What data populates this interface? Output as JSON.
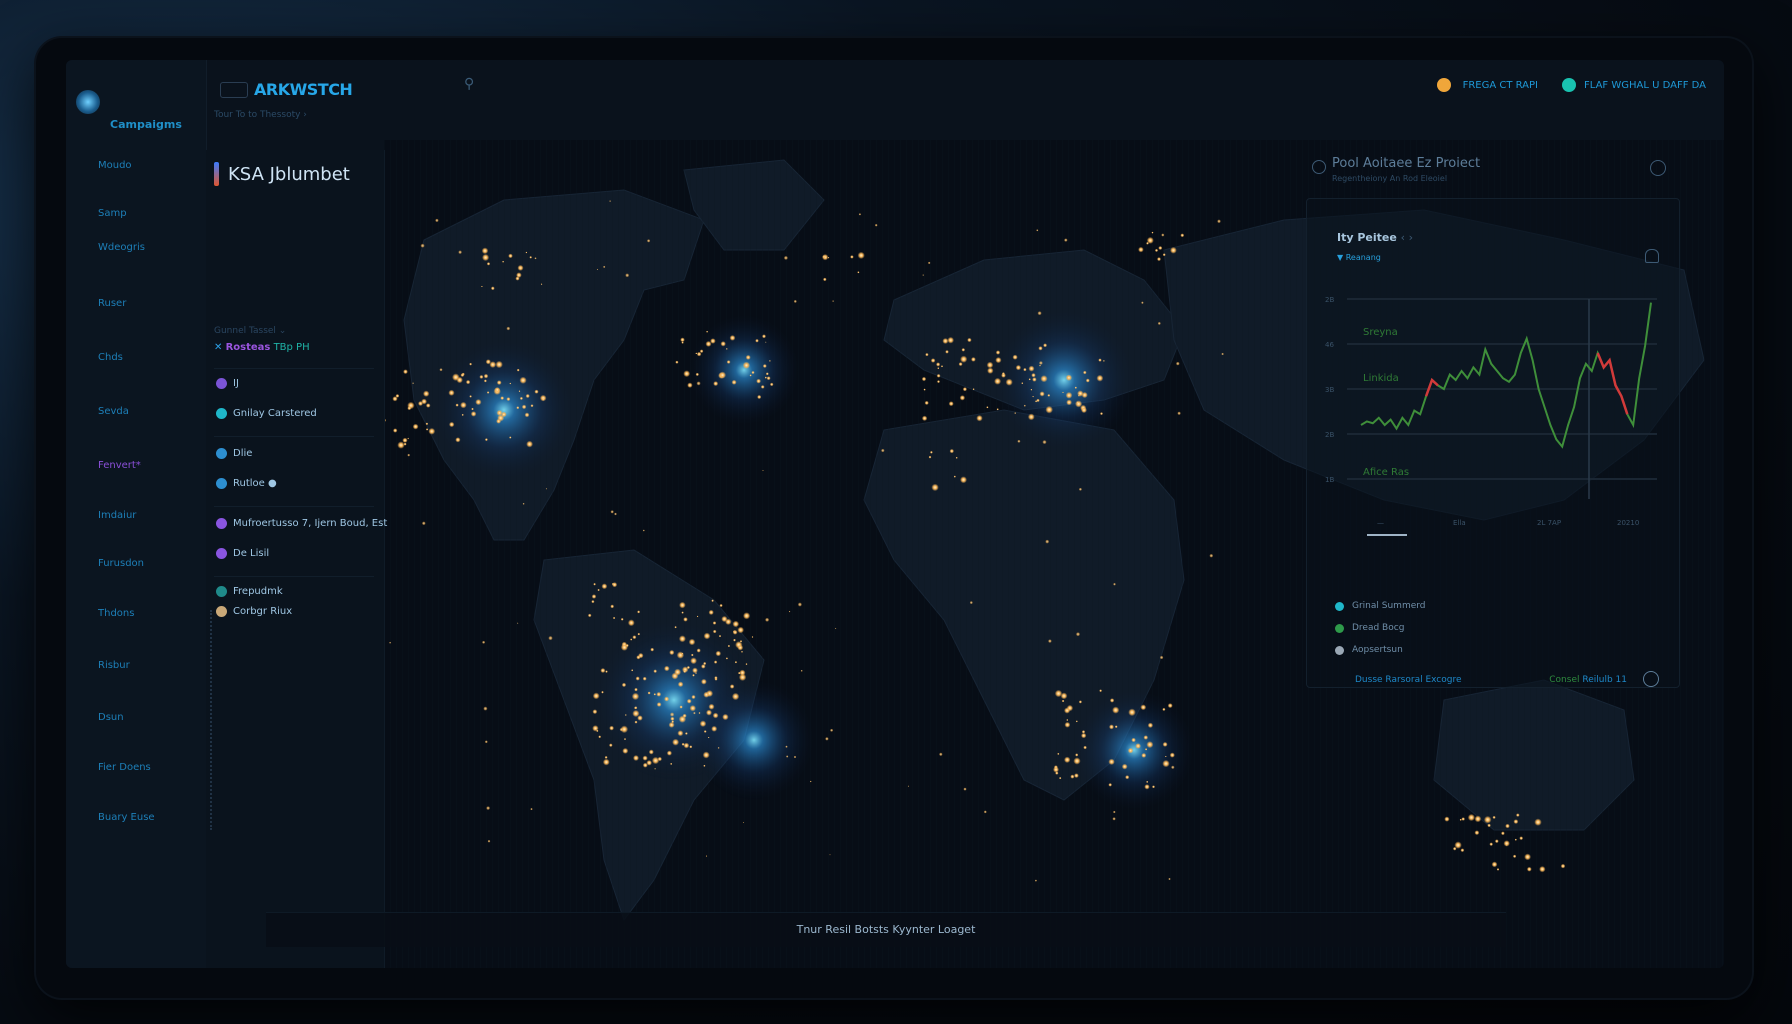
{
  "app": {
    "brand": "ARKWSTCH",
    "breadcrumb": "Tour To to Thessoty ›",
    "workspace": "Campaigms"
  },
  "header": {
    "status_1": "FREGA CT RAPI",
    "status_2": "FLAF WGHAL U DAFF DA",
    "status_1_color": "#f0a63a",
    "status_2_color": "#19c2b0"
  },
  "sidebar": {
    "items": [
      {
        "label": "Moudo"
      },
      {
        "label": "Samp"
      },
      {
        "label": "Wdeogris"
      },
      {
        "label": "Ruser"
      },
      {
        "label": "Chds"
      },
      {
        "label": "Sevda"
      },
      {
        "label": "Fenvert*",
        "active": true
      },
      {
        "label": "Imdaiur"
      },
      {
        "label": "Furusdon"
      },
      {
        "label": "Thdons"
      },
      {
        "label": "Risbur"
      },
      {
        "label": "Dsun"
      },
      {
        "label": "Fier Doens"
      },
      {
        "label": "Buary Euse"
      }
    ]
  },
  "left_panel": {
    "title": "KSA Jblumbet",
    "filter_label": "Gunnel Tassel ⌄",
    "filter_chip_name": "Rosteas",
    "filter_chip_value": "TBp PH",
    "layers": [
      {
        "label": "IJ",
        "icon": "circle-icon",
        "color": "#7b54d6"
      },
      {
        "label": "Gnilay Carstered",
        "icon": "heart-icon",
        "color": "#1fb7c9"
      },
      {
        "label": "Dlie",
        "icon": "circle-icon",
        "color": "#2d8fd0"
      },
      {
        "label": "Rutloe ●",
        "icon": "pin-icon",
        "color": "#2d8fd0"
      },
      {
        "label": "Mufroertusso 7, Ijern Boud, Est",
        "icon": "circle-icon",
        "color": "#8a55e0"
      },
      {
        "label": "De Lisil",
        "icon": "circle-icon",
        "color": "#8a55e0"
      },
      {
        "label": "Frepudmk",
        "icon": "circle-icon",
        "color": "#1f8a8a"
      },
      {
        "label": "Corbgr Riux",
        "icon": "circle-icon",
        "color": "#c9a878"
      }
    ]
  },
  "right_panel": {
    "title": "Pool Aoitaee Ez Proiect",
    "subtitle": "Regentheiony An Rod Eleoiel",
    "section": "Ity Peitee",
    "section_suffix": "‹ ›",
    "filter": "Reanang",
    "legend": [
      {
        "label": "Grinal Summerd",
        "color": "#1fb7c9"
      },
      {
        "label": "Dread Bocg",
        "color": "#2e9a4a"
      },
      {
        "label": "Aopsertsun",
        "color": "#9aa8b5"
      }
    ],
    "footer_left": "Dusse Rarsoral Excogre",
    "footer_right_green": "Consel",
    "footer_right_blue": "Reilulb 11"
  },
  "chart_data": {
    "type": "line",
    "title": "",
    "xlabel": "",
    "ylabel": "",
    "y_ticks": [
      "2B",
      "46",
      "3B",
      "2B",
      "1B"
    ],
    "x_ticks": [
      "—",
      "Ella",
      "2L 7AP",
      "20210"
    ],
    "annotations": [
      "Sreyna",
      "Linkida",
      "Afice Ras"
    ],
    "colors": {
      "up": "#3f8f3a",
      "down": "#d23a3a"
    },
    "series": [
      {
        "values": [
          0.3,
          0.32,
          0.31,
          0.34,
          0.3,
          0.33,
          0.28,
          0.34,
          0.3,
          0.38,
          0.36,
          0.46,
          0.55,
          0.52,
          0.5,
          0.58,
          0.55,
          0.6,
          0.56,
          0.62,
          0.58,
          0.72,
          0.64,
          0.6,
          0.56,
          0.54,
          0.58,
          0.7,
          0.78,
          0.66,
          0.5,
          0.4,
          0.3,
          0.22,
          0.18,
          0.3,
          0.4,
          0.56,
          0.64,
          0.6,
          0.7,
          0.62,
          0.66,
          0.52,
          0.46,
          0.36,
          0.3,
          0.56,
          0.74,
          0.98
        ]
      }
    ],
    "down_ranges": [
      [
        11,
        13
      ],
      [
        40,
        45
      ]
    ]
  }
}
